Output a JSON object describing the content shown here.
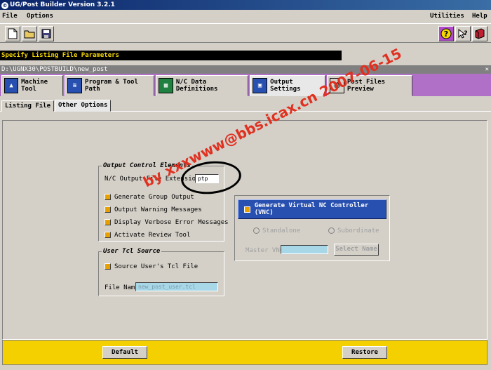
{
  "window": {
    "title": "UG/Post Builder Version 3.2.1",
    "app_icon_glyph": "©"
  },
  "menu": {
    "file": "File",
    "options": "Options",
    "utilities": "Utilities",
    "help": "Help"
  },
  "toolbar": {
    "icons": [
      "new-file-icon",
      "open-folder-icon",
      "save-icon",
      "help-question-icon",
      "context-help-icon",
      "manual-book-icon"
    ]
  },
  "status_message": "Specify Listing File Parameters",
  "path": "D:\\UGNX30\\POSTBUILD\\new_post",
  "main_tabs": [
    {
      "label": "Machine Tool"
    },
    {
      "label": "Program & Tool Path"
    },
    {
      "label": "N/C Data Definitions"
    },
    {
      "label": "Output Settings"
    },
    {
      "label": "Post Files Preview"
    }
  ],
  "sub_tabs": [
    {
      "label": "Listing File"
    },
    {
      "label": "Other Options"
    }
  ],
  "output_control": {
    "title": "Output Control Elements",
    "extension_label": "N/C Output File Extension",
    "extension_value": "ptp",
    "options": [
      "Generate Group Output",
      "Output Warning Messages",
      "Display Verbose Error Messages",
      "Activate Review Tool"
    ]
  },
  "tcl_source": {
    "title": "User Tcl Source",
    "checkbox_label": "Source User's Tcl File",
    "file_name_label": "File Name",
    "file_name_value": "new_post_user.tcl"
  },
  "vnc": {
    "button_label": "Generate Virtual NC Controller (VNC)",
    "standalone_label": "Standalone",
    "subordinate_label": "Subordinate",
    "master_label": "Master VNC",
    "select_button": "Select Name"
  },
  "footer": {
    "default_label": "Default",
    "restore_label": "Restore"
  },
  "watermark": "by xxxwww@bbs.icax.cn 2007-06-15",
  "colors": {
    "accent_purple": "#b070c8",
    "footer_yellow": "#f5d000",
    "checkbox_orange": "#e8a000",
    "vnc_blue": "#2850b0"
  }
}
